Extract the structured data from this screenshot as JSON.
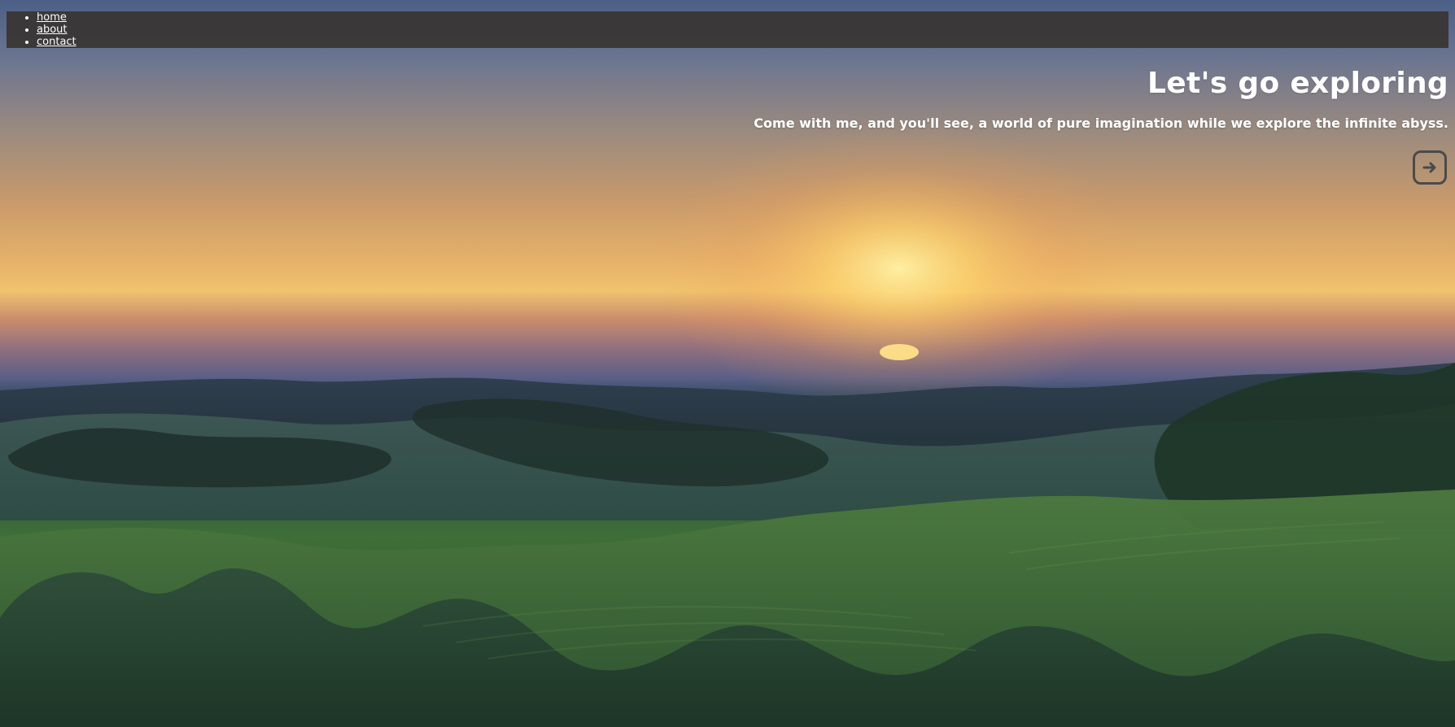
{
  "nav": {
    "items": [
      {
        "label": "home"
      },
      {
        "label": "about"
      },
      {
        "label": "contact"
      }
    ]
  },
  "hero": {
    "title": "Let's go exploring",
    "subtitle": "Come with me, and you'll see, a world of pure imagination while we explore the infinite abyss.",
    "cta_icon": "arrow-right-icon"
  },
  "colors": {
    "nav_background": "#383432",
    "text": "#ffffff",
    "cta_border": "#4a4a4a",
    "sun": "#ffe08a"
  }
}
